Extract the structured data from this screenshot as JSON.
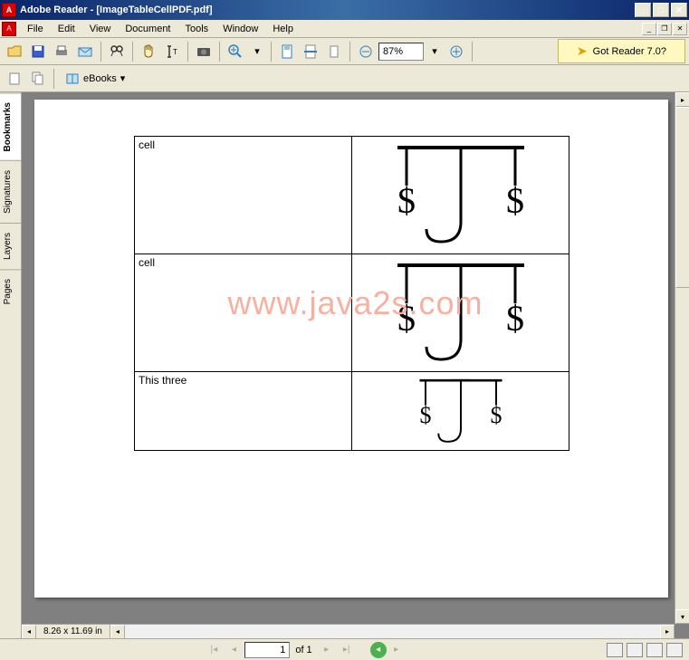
{
  "title": "Adobe Reader - [ImageTableCellPDF.pdf]",
  "menubar": [
    "File",
    "Edit",
    "View",
    "Document",
    "Tools",
    "Window",
    "Help"
  ],
  "toolbar": {
    "zoom_value": "87%",
    "got_reader": "Got Reader 7.0?"
  },
  "toolbar2": {
    "ebooks_label": "eBooks"
  },
  "side_tabs": [
    "Bookmarks",
    "Signatures",
    "Layers",
    "Pages"
  ],
  "document": {
    "rows": [
      {
        "label": "cell",
        "img_scale": 1.0
      },
      {
        "label": "cell",
        "img_scale": 1.0
      },
      {
        "label": "This three",
        "img_scale": 0.65
      }
    ],
    "watermark": "www.java2s.com"
  },
  "status": {
    "page_size": "8.26 x 11.69 in",
    "page_current": "1",
    "page_total": "of 1"
  }
}
